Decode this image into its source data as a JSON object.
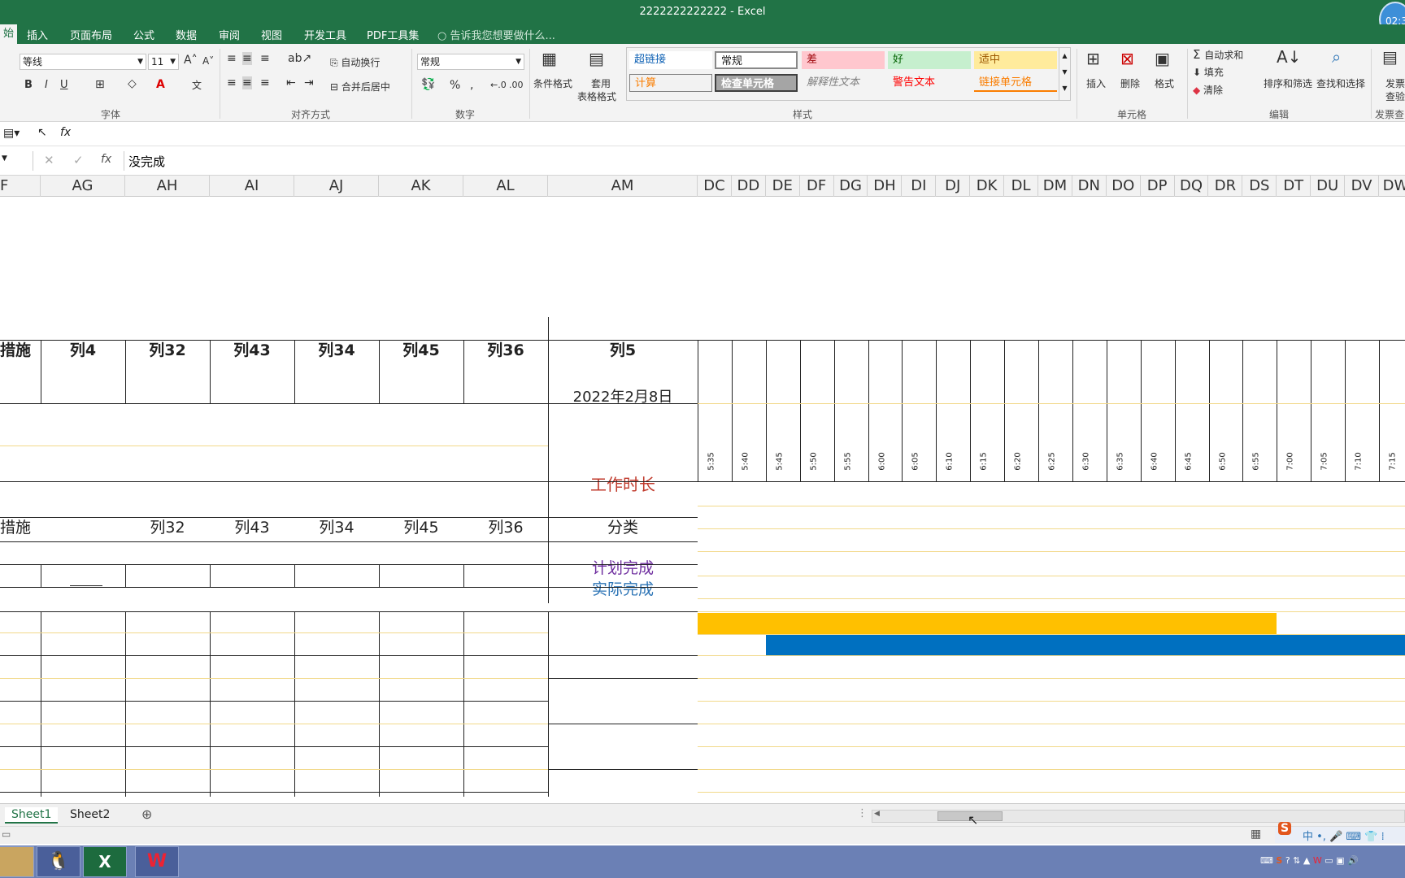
{
  "window": {
    "title": "2222222222222 - Excel",
    "clock": "02:3"
  },
  "tabs": [
    "始",
    "插入",
    "页面布局",
    "公式",
    "数据",
    "审阅",
    "视图",
    "开发工具",
    "PDF工具集"
  ],
  "tell_me": "告诉我您想要做什么...",
  "ribbon": {
    "font_name": "等线",
    "font_size": "11",
    "bold": "B",
    "italic": "I",
    "underline": "U",
    "wrap_text": "自动换行",
    "merge_center": "合并后居中",
    "number_format": "常规",
    "percent": "%",
    "comma": ",",
    "cond_format": "条件格式",
    "table_format_1": "套用",
    "table_format_2": "表格格式",
    "styles": [
      {
        "label": "超链接",
        "bg": "#ffffff",
        "fg": "#0b5fb3"
      },
      {
        "label": "常规",
        "bg": "#ffffff",
        "fg": "#222222"
      },
      {
        "label": "差",
        "bg": "#ffc7ce",
        "fg": "#9c0006"
      },
      {
        "label": "好",
        "bg": "#c6efce",
        "fg": "#006100"
      },
      {
        "label": "适中",
        "bg": "#ffeb9c",
        "fg": "#9c5700"
      },
      {
        "label": "计算",
        "bg": "#f2f2f2",
        "fg": "#fa7d00"
      },
      {
        "label": "检查单元格",
        "bg": "#a5a5a5",
        "fg": "#ffffff"
      },
      {
        "label": "解释性文本",
        "bg": "#f3f3f3",
        "fg": "#7f7f7f"
      },
      {
        "label": "警告文本",
        "bg": "#f3f3f3",
        "fg": "#ff0000"
      },
      {
        "label": "链接单元格",
        "bg": "#f3f3f3",
        "fg": "#fa7d00"
      }
    ],
    "insert": "插入",
    "delete": "删除",
    "format": "格式",
    "autosum": "自动求和",
    "fill": "填充",
    "clear": "清除",
    "sort_filter": "排序和筛选",
    "find_select": "查找和选择",
    "invoice_1": "发票",
    "invoice_2": "查验",
    "groups": [
      "字体",
      "对齐方式",
      "数字",
      "样式",
      "单元格",
      "编辑",
      "发票查"
    ]
  },
  "formula": {
    "fx": "fx",
    "content": "没完成"
  },
  "columns_left": [
    "F",
    "AG",
    "AH",
    "AI",
    "AJ",
    "AK",
    "AL",
    "AM"
  ],
  "columns_right": [
    "DC",
    "DD",
    "DE",
    "DF",
    "DG",
    "DH",
    "DI",
    "DJ",
    "DK",
    "DL",
    "DM",
    "DN",
    "DO",
    "DP",
    "DQ",
    "DR",
    "DS",
    "DT",
    "DU",
    "DV",
    "DW"
  ],
  "header_row": [
    "措施",
    "列4",
    "列32",
    "列43",
    "列34",
    "列45",
    "列36",
    "列5"
  ],
  "date": "2022年2月8日",
  "times": [
    "5:35",
    "5:40",
    "5:45",
    "5:50",
    "5:55",
    "6:00",
    "6:05",
    "6:10",
    "6:15",
    "6:20",
    "6:25",
    "6:30",
    "6:35",
    "6:40",
    "6:45",
    "6:50",
    "6:55",
    "7:00",
    "7:05",
    "7:10",
    "7:15"
  ],
  "work_duration": "工作时长",
  "second_header": [
    "措施",
    "",
    "列32",
    "列43",
    "列34",
    "列45",
    "列36",
    "分类"
  ],
  "plan_label": "计划完成",
  "actual_label": "实际完成",
  "gantt": {
    "plan_start": 0,
    "plan_end": 17,
    "actual_start": 2,
    "actual_end": 21,
    "plan_color": "#ffc000",
    "actual_color": "#0070c0"
  },
  "colors": {
    "excel_green": "#217346",
    "work_duration": "#c0392b",
    "plan_label": "#7030a0",
    "actual_label": "#2e75b6"
  },
  "sheets": [
    "Sheet1",
    "Sheet2"
  ]
}
